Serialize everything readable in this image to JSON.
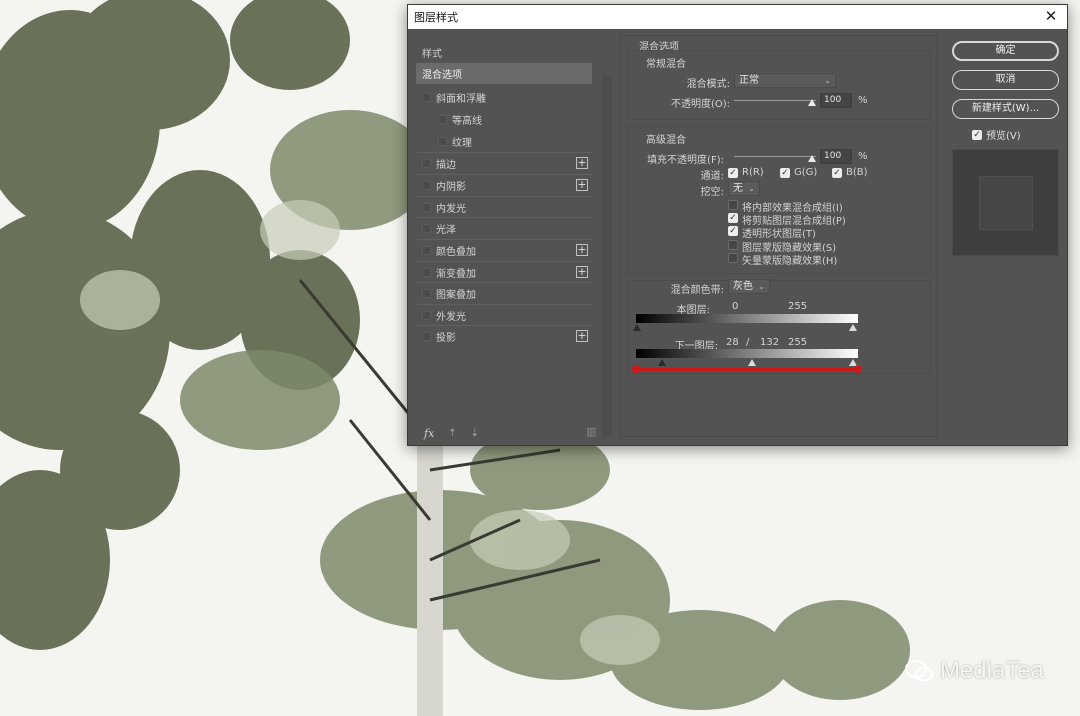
{
  "dialog": {
    "title": "图层样式",
    "close_icon": "close-icon"
  },
  "style_list": {
    "header": "样式",
    "items": [
      {
        "label": "混合选项",
        "selected": true,
        "checkbox": false,
        "plus": false
      },
      {
        "label": "斜面和浮雕",
        "checkbox": true,
        "plus": false
      },
      {
        "label": "等高线",
        "checkbox": true,
        "plus": false,
        "indent": true
      },
      {
        "label": "纹理",
        "checkbox": true,
        "plus": false,
        "indent": true
      },
      {
        "label": "描边",
        "checkbox": true,
        "plus": true
      },
      {
        "label": "内阴影",
        "checkbox": true,
        "plus": true
      },
      {
        "label": "内发光",
        "checkbox": true,
        "plus": false
      },
      {
        "label": "光泽",
        "checkbox": true,
        "plus": false
      },
      {
        "label": "颜色叠加",
        "checkbox": true,
        "plus": true
      },
      {
        "label": "渐变叠加",
        "checkbox": true,
        "plus": true
      },
      {
        "label": "图案叠加",
        "checkbox": true,
        "plus": false
      },
      {
        "label": "外发光",
        "checkbox": true,
        "plus": false
      },
      {
        "label": "投影",
        "checkbox": true,
        "plus": true
      }
    ],
    "footer": {
      "fx": "fx",
      "up": "⇡",
      "down": "⇣",
      "trash": "🗑"
    }
  },
  "blend_options": {
    "title": "混合选项",
    "general": {
      "title": "常规混合",
      "mode_label": "混合模式:",
      "mode_value": "正常",
      "opacity_label": "不透明度(O):",
      "opacity_value": "100",
      "opacity_unit": "%"
    },
    "advanced": {
      "title": "高级混合",
      "fill_label": "填充不透明度(F):",
      "fill_value": "100",
      "fill_unit": "%",
      "channels_label": "通道:",
      "channels": [
        "R(R)",
        "G(G)",
        "B(B)"
      ],
      "knockout_label": "挖空:",
      "knockout_value": "无",
      "options": [
        {
          "label": "将内部效果混合成组(I)",
          "checked": false
        },
        {
          "label": "将剪贴图层混合成组(P)",
          "checked": true
        },
        {
          "label": "透明形状图层(T)",
          "checked": true
        },
        {
          "label": "图层蒙版隐藏效果(S)",
          "checked": false
        },
        {
          "label": "矢量蒙版隐藏效果(H)",
          "checked": false
        }
      ]
    },
    "blend_if": {
      "label": "混合颜色带:",
      "value": "灰色",
      "this_layer_label": "本图层:",
      "this_layer_low": "0",
      "this_layer_high": "255",
      "under_layer_label": "下一图层:",
      "under_layer_low": "28",
      "under_layer_sep": "/",
      "under_layer_mid": "132",
      "under_layer_high": "255"
    }
  },
  "buttons": {
    "ok": "确定",
    "cancel": "取消",
    "new_style": "新建样式(W)...",
    "preview_label": "预览(V)"
  },
  "watermark": "MediaTea",
  "colors": {
    "dialog_bg": "#535353",
    "highlight": "#d01818"
  }
}
